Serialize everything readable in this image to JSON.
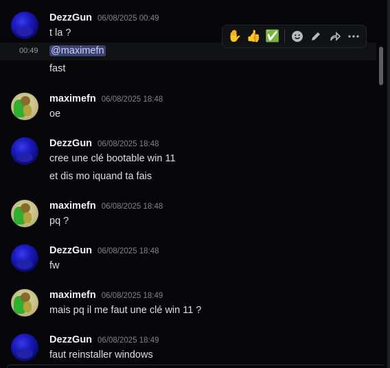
{
  "messages": [
    {
      "user": "DezzGun",
      "time": "06/08/2025 00:49",
      "lines": [
        "t la ?"
      ]
    },
    {
      "hover_time": "00:49",
      "mention": "@maximefn",
      "lines": [
        "fast"
      ]
    },
    {
      "user": "maximefn",
      "time": "06/08/2025 18:48",
      "lines": [
        "oe"
      ]
    },
    {
      "user": "DezzGun",
      "time": "06/08/2025 18:48",
      "lines": [
        "cree une clé bootable win 11",
        "et dis mo iquand ta fais"
      ]
    },
    {
      "user": "maximefn",
      "time": "06/08/2025 18:48",
      "lines": [
        "pq ?"
      ]
    },
    {
      "user": "DezzGun",
      "time": "06/08/2025 18:48",
      "lines": [
        "fw"
      ]
    },
    {
      "user": "maximefn",
      "time": "06/08/2025 18:49",
      "lines": [
        "mais pq il me faut une clé win 11 ?"
      ]
    },
    {
      "user": "DezzGun",
      "time": "06/08/2025 18:49",
      "lines": [
        "faut reinstaller windows"
      ]
    }
  ],
  "toolbar": {
    "reactions": [
      "✋",
      "👍",
      "✅"
    ],
    "icons": [
      "emoji-icon",
      "edit-icon",
      "reply-icon",
      "more-icon"
    ]
  }
}
